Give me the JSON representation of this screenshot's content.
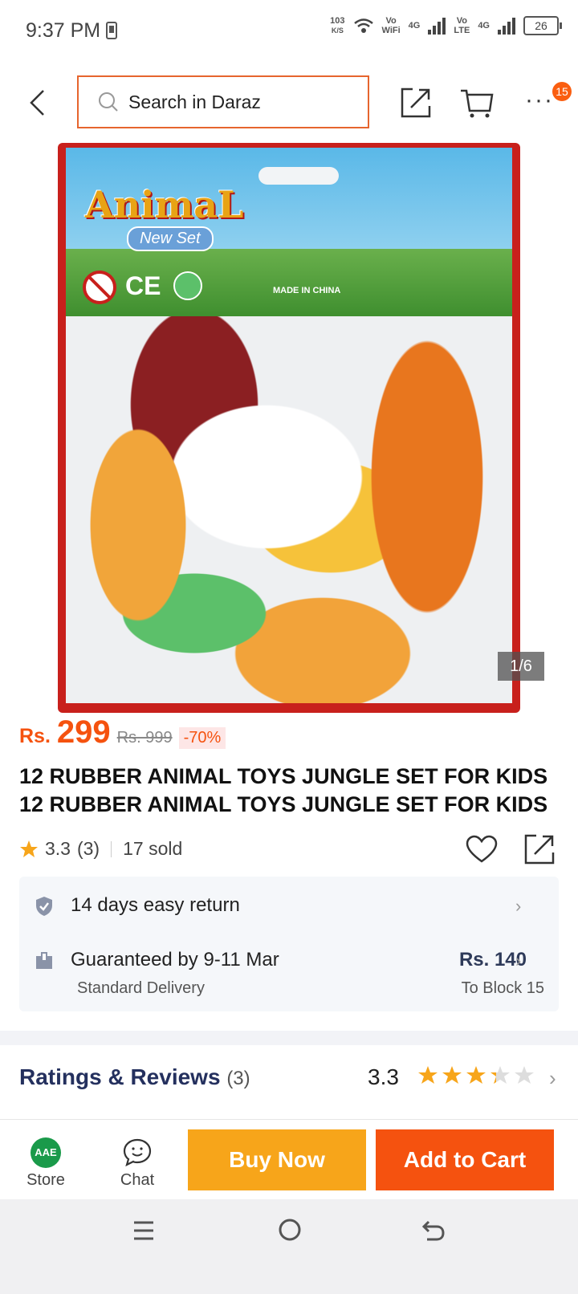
{
  "status_bar": {
    "time": "9:37 PM",
    "speed_value": "103",
    "speed_unit": "K/S",
    "vowifi_top": "Vo",
    "vowifi_bottom": "WiFi",
    "net1": "4G",
    "volte_top": "Vo",
    "volte_bottom": "LTE",
    "net2": "4G",
    "battery": "26"
  },
  "header": {
    "search_placeholder": "Search in Daraz",
    "more_badge": "15"
  },
  "gallery": {
    "brand_text": "AnimaL",
    "brand_sub": "New Set",
    "made_in": "MADE IN CHINA",
    "ce_mark": "CE",
    "counter": "1/6"
  },
  "product": {
    "currency": "Rs.",
    "price": "299",
    "original_price": "Rs. 999",
    "discount": "-70%",
    "title": "12 RUBBER ANIMAL TOYS JUNGLE SET FOR KIDS 12 RUBBER ANIMAL TOYS JUNGLE SET FOR KIDS",
    "rating": "3.3",
    "rating_count": "(3)",
    "sold": "17 sold"
  },
  "service": {
    "return_text": "14 days easy return",
    "delivery_text": "Guaranteed by 9-11 Mar",
    "delivery_type": "Standard Delivery",
    "delivery_fee": "Rs. 140",
    "delivery_to": "To Block 15"
  },
  "reviews": {
    "title": "Ratings & Reviews",
    "count": "(3)",
    "score": "3.3",
    "stars_value": 3.3,
    "stars_max": 5
  },
  "bottom_bar": {
    "store_label": "Store",
    "store_logo_text": "AAE",
    "chat_label": "Chat",
    "buy_now": "Buy Now",
    "add_to_cart": "Add to Cart"
  },
  "colors": {
    "accent": "#f5520f",
    "buy_now": "#f7a51a",
    "star": "#f7a51a",
    "title_dark": "#24305e"
  }
}
